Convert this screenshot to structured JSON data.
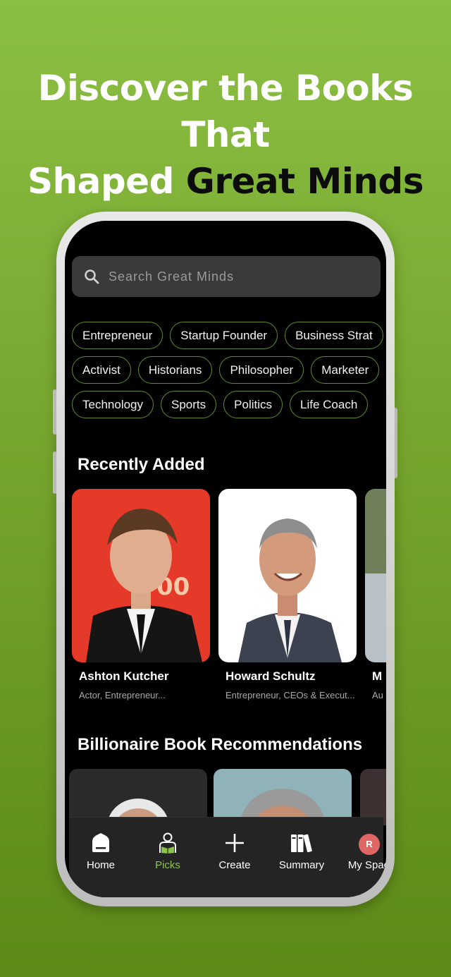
{
  "headline": {
    "line1": "Discover the Books That",
    "line2_light": "Shaped",
    "line2_dark": "Great Minds"
  },
  "search": {
    "placeholder": "Search Great Minds",
    "icon": "search-icon"
  },
  "chips": {
    "row1": [
      "Entrepreneur",
      "Startup Founder",
      "Business Strat"
    ],
    "row2": [
      "Activist",
      "Historians",
      "Philosopher",
      "Marketer"
    ],
    "row3": [
      "Technology",
      "Sports",
      "Politics",
      "Life Coach"
    ]
  },
  "recently_added": {
    "title": "Recently Added",
    "people": [
      {
        "name": "Ashton Kutcher",
        "role": "Actor, Entrepreneur..."
      },
      {
        "name": "Howard Schultz",
        "role": "Entrepreneur, CEOs & Execut..."
      },
      {
        "name": "M",
        "role": "Au"
      }
    ]
  },
  "billionaire": {
    "title": "Billionaire Book Recommendations"
  },
  "nav": {
    "items": [
      {
        "label": "Home",
        "icon": "home-icon"
      },
      {
        "label": "Picks",
        "icon": "reader-icon"
      },
      {
        "label": "Create",
        "icon": "plus-icon"
      },
      {
        "label": "Summary",
        "icon": "books-icon"
      },
      {
        "label": "My Spac",
        "icon": "avatar"
      }
    ],
    "active": "Picks",
    "avatar_initial": "R",
    "active_color": "#8bc34a"
  },
  "colors": {
    "background": "#76a52e",
    "chip_border": "#5f8a2a",
    "avatar": "#e06666"
  }
}
